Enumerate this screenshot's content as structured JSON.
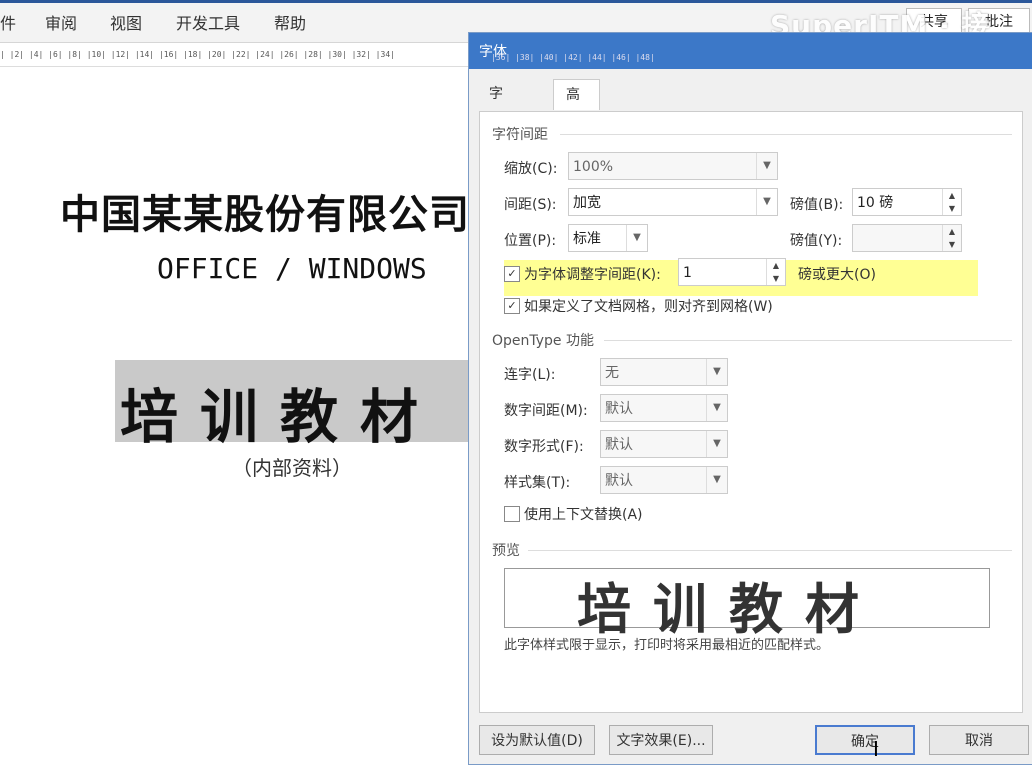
{
  "menu": {
    "file_partial": "件",
    "review": "审阅",
    "view": "视图",
    "developer": "开发工具",
    "help": "帮助"
  },
  "banner": {
    "text": "SuperITM · 接"
  },
  "share": {
    "label": "共享",
    "label2": "批注"
  },
  "ruler": {
    "text": "|  |2|  |4|  |6|  |8|  |10|  |12|  |14|  |16|  |18|  |20|  |22|  |24|  |26|  |28|  |30|  |32|  |34|"
  },
  "document": {
    "title": "中国某某股份有限公司",
    "subtitle": "OFFICE / WINDOWS",
    "band_text": "培训教材",
    "note": "（内部资料）"
  },
  "dialog": {
    "title": "字体",
    "ruler": "|36|  |38|  |40|  |42|  |44|  |46|  |48|",
    "tabs": [
      {
        "label": "字体(N)"
      },
      {
        "label": "高级(V)"
      }
    ],
    "spacing_section": "字符间距",
    "scale_label": "缩放(C):",
    "scale_value": "100%",
    "spacing_label": "间距(S):",
    "spacing_value": "加宽",
    "spacing_pt_label": "磅值(B):",
    "spacing_pt_value": "10 磅",
    "position_label": "位置(P):",
    "position_value": "标准",
    "position_pt_label": "磅值(Y):",
    "kerning_label": "为字体调整字间距(K):",
    "kerning_value": "1",
    "kerning_suffix": "磅或更大(O)",
    "grid_label": "如果定义了文档网格，则对齐到网格(W)",
    "opentype_section": "OpenType 功能",
    "ligatures_label": "连字(L):",
    "ligatures_value": "无",
    "num_spacing_label": "数字间距(M):",
    "num_spacing_value": "默认",
    "num_form_label": "数字形式(F):",
    "num_form_value": "默认",
    "style_set_label": "样式集(T):",
    "style_set_value": "默认",
    "contextual_label": "使用上下文替换(A)",
    "preview_section": "预览",
    "preview_text": "培训教材",
    "preview_note": "此字体样式限于显示，打印时将采用最相近的匹配样式。",
    "set_default": "设为默认值(D)",
    "text_effects": "文字效果(E)...",
    "ok": "确定",
    "cancel": "取消"
  },
  "colors": {
    "highlight": "#ffff66",
    "title_bar": "#3c78c8"
  }
}
